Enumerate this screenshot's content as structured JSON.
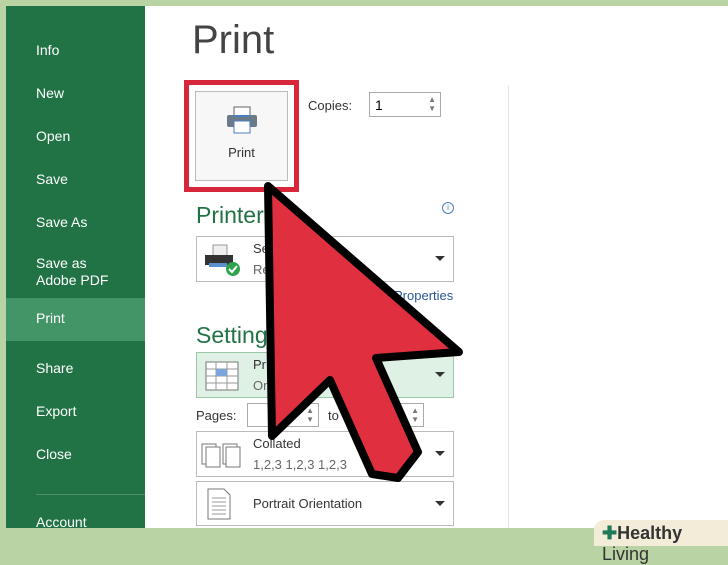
{
  "sidebar": {
    "items": [
      {
        "label": "Info"
      },
      {
        "label": "New"
      },
      {
        "label": "Open"
      },
      {
        "label": "Save"
      },
      {
        "label": "Save As"
      },
      {
        "label": "Save as Adobe PDF"
      },
      {
        "label": "Print",
        "selected": true
      },
      {
        "label": "Share"
      },
      {
        "label": "Export"
      },
      {
        "label": "Close"
      },
      {
        "label": "Account"
      }
    ]
  },
  "main": {
    "title": "Print",
    "print_button": "Print",
    "copies_label": "Copies:",
    "copies_value": "1",
    "printer_heading": "Printer",
    "printer_name": "Se          te 2013",
    "printer_status": "Re",
    "printer_properties": "Properties",
    "settings_heading": "Settings",
    "print_what": "Pr",
    "print_what_sub": "On                  electi...",
    "pages_label": "Pages:",
    "to_label": "to",
    "collated": "Collated",
    "collated_sub": "1,2,3    1,2,3    1,2,3",
    "orientation": "Portrait Orientation"
  },
  "watermark": {
    "brand_bold": "Healthy",
    "brand": "Living"
  },
  "colors": {
    "sidebar": "#217346",
    "sidebar_selected": "#439467",
    "highlight": "#d8263a",
    "arrow": "#e03040"
  }
}
